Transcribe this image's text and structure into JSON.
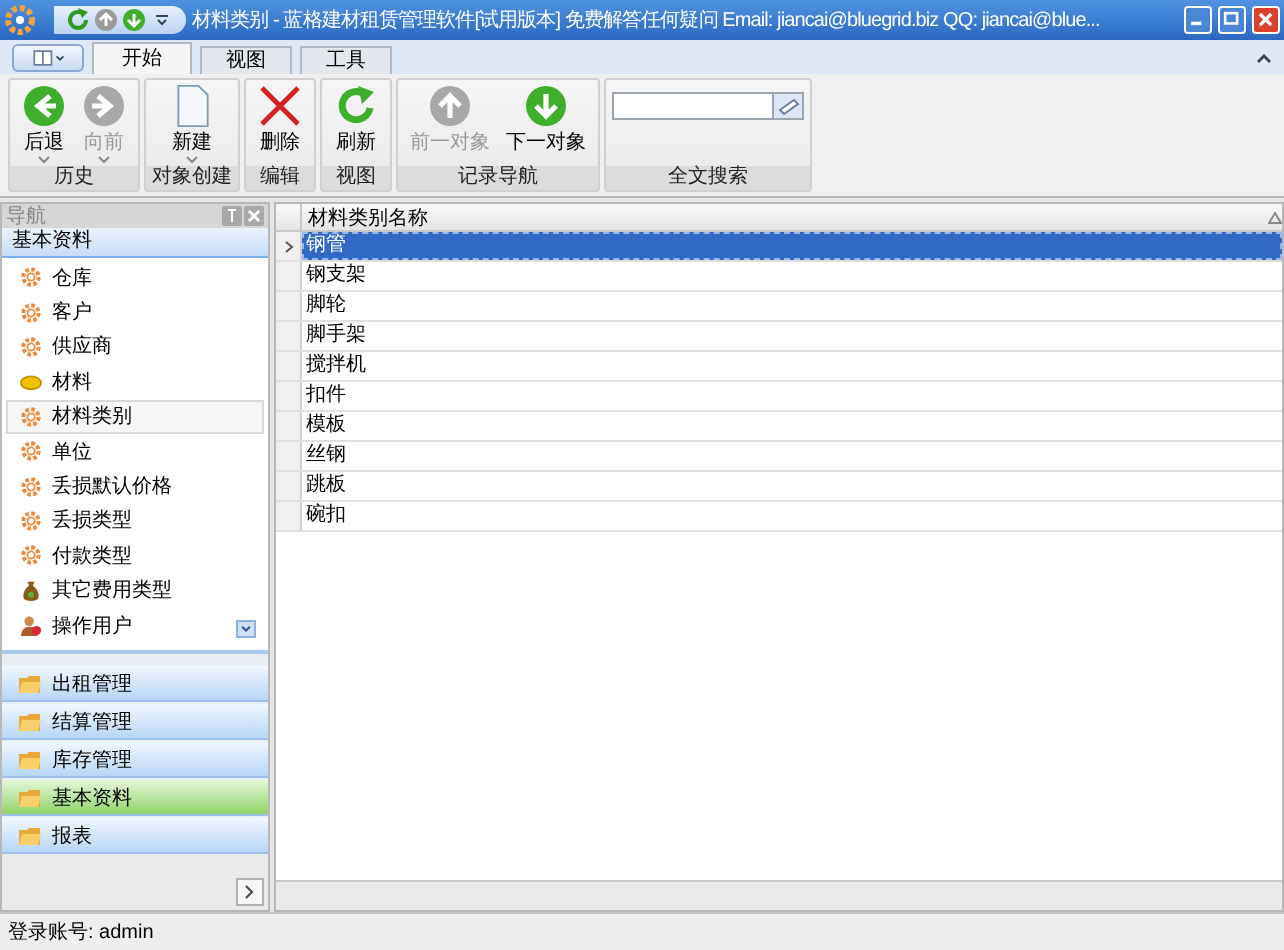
{
  "window": {
    "title": "材料类别 - 蓝格建材租赁管理软件[试用版本] 免费解答任何疑问 Email: jiancai@bluegrid.biz QQ: jiancai@blue..."
  },
  "tabs": [
    {
      "label": "开始",
      "selected": true
    },
    {
      "label": "视图",
      "selected": false
    },
    {
      "label": "工具",
      "selected": false
    }
  ],
  "ribbon_groups": [
    {
      "label": "历史",
      "kind": "buttons",
      "buttons": [
        {
          "label": "后退",
          "kind": "back",
          "disabled": false,
          "dropdown": true
        },
        {
          "label": "向前",
          "kind": "forward",
          "disabled": true,
          "dropdown": true
        }
      ]
    },
    {
      "label": "对象创建",
      "kind": "buttons",
      "buttons": [
        {
          "label": "新建",
          "kind": "page",
          "disabled": false,
          "dropdown": true
        }
      ]
    },
    {
      "label": "编辑",
      "kind": "buttons",
      "buttons": [
        {
          "label": "删除",
          "kind": "delete",
          "disabled": false,
          "dropdown": false
        }
      ]
    },
    {
      "label": "视图",
      "kind": "buttons",
      "buttons": [
        {
          "label": "刷新",
          "kind": "refresh",
          "disabled": false,
          "dropdown": false
        }
      ]
    },
    {
      "label": "记录导航",
      "kind": "buttons",
      "buttons": [
        {
          "label": "前一对象",
          "kind": "up",
          "disabled": true,
          "dropdown": false
        },
        {
          "label": "下一对象",
          "kind": "down",
          "disabled": false,
          "dropdown": false
        }
      ]
    },
    {
      "label": "全文搜索",
      "kind": "search"
    }
  ],
  "navigation": {
    "title": "导航",
    "section": "基本资料",
    "items": [
      {
        "label": "仓库",
        "kind": "gear",
        "selected": false
      },
      {
        "label": "客户",
        "kind": "gear",
        "selected": false
      },
      {
        "label": "供应商",
        "kind": "gear",
        "selected": false
      },
      {
        "label": "材料",
        "kind": "lemon",
        "selected": false
      },
      {
        "label": "材料类别",
        "kind": "gear",
        "selected": true
      },
      {
        "label": "单位",
        "kind": "gear",
        "selected": false
      },
      {
        "label": "丢损默认价格",
        "kind": "gear",
        "selected": false
      },
      {
        "label": "丢损类型",
        "kind": "gear",
        "selected": false
      },
      {
        "label": "付款类型",
        "kind": "gear",
        "selected": false
      },
      {
        "label": "其它费用类型",
        "kind": "bag",
        "selected": false
      },
      {
        "label": "操作用户",
        "kind": "user",
        "selected": false
      }
    ],
    "groups": [
      {
        "label": "出租管理",
        "selected": false
      },
      {
        "label": "结算管理",
        "selected": false
      },
      {
        "label": "库存管理",
        "selected": false
      },
      {
        "label": "基本资料",
        "selected": true
      },
      {
        "label": "报表",
        "selected": false
      }
    ]
  },
  "grid": {
    "columns": [
      "材料类别名称"
    ],
    "rows": [
      {
        "name": "钢管",
        "selected": true
      },
      {
        "name": "钢支架",
        "selected": false
      },
      {
        "name": "脚轮",
        "selected": false
      },
      {
        "name": "脚手架",
        "selected": false
      },
      {
        "name": "搅拌机",
        "selected": false
      },
      {
        "name": "扣件",
        "selected": false
      },
      {
        "name": "模板",
        "selected": false
      },
      {
        "name": "丝钢",
        "selected": false
      },
      {
        "name": "跳板",
        "selected": false
      },
      {
        "name": "碗扣",
        "selected": false
      }
    ]
  },
  "status_bar": "登录账号: admin"
}
